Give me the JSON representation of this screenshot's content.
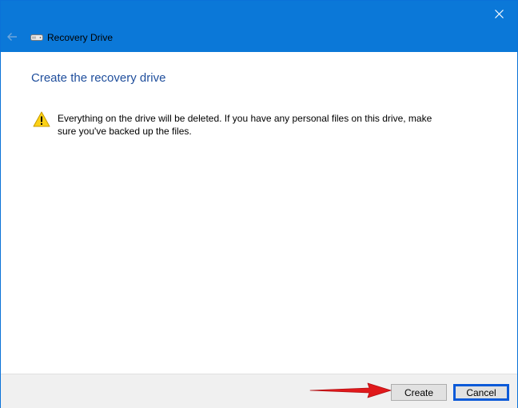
{
  "window": {
    "title": "Recovery Drive",
    "back_icon": "back-arrow-icon",
    "drive_icon": "drive-icon",
    "close_icon": "close-icon",
    "accent_color": "#0b78d8"
  },
  "content": {
    "heading": "Create the recovery drive",
    "warning_icon": "warning-triangle-icon",
    "warning_text": "Everything on the drive will be deleted. If you have any personal files on this drive, make sure you've backed up the files."
  },
  "footer": {
    "create_label": "Create",
    "cancel_label": "Cancel"
  },
  "annotation": {
    "arrow_icon": "red-arrow-icon",
    "arrow_color": "#e0191b"
  }
}
